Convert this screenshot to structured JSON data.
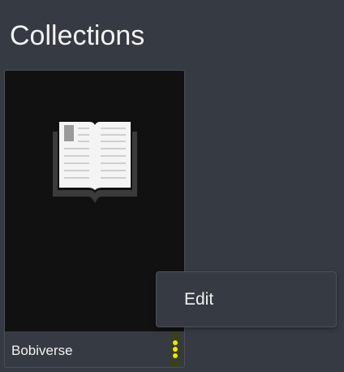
{
  "page": {
    "title": "Collections"
  },
  "collections": [
    {
      "name": "Bobiverse",
      "cover_icon": "open-book-icon",
      "menu_icon": "kebab-menu-icon"
    }
  ],
  "context_menu": {
    "items": [
      {
        "label": "Edit"
      }
    ]
  },
  "colors": {
    "background": "#363a42",
    "cover": "#111111",
    "menu_dots": "#f3e20a"
  }
}
